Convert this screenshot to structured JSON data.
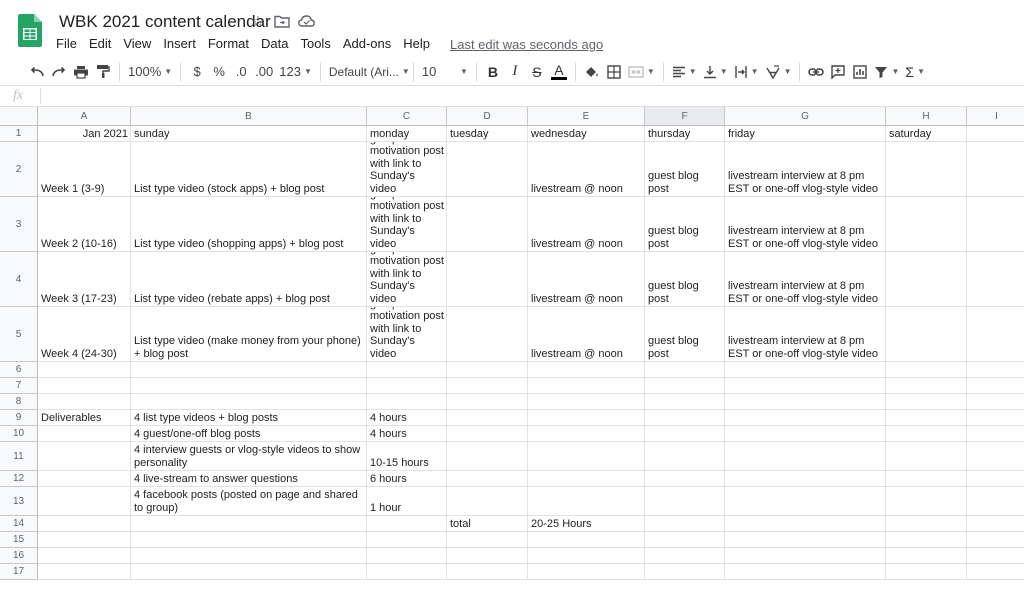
{
  "doc": {
    "title": "WBK 2021 content calendar",
    "last_edit": "Last edit was seconds ago"
  },
  "icons": {
    "star": "star-icon",
    "move": "folder-move-icon",
    "cloud": "cloud-status-icon"
  },
  "menu": [
    "File",
    "Edit",
    "View",
    "Insert",
    "Format",
    "Data",
    "Tools",
    "Add-ons",
    "Help"
  ],
  "toolbar": {
    "zoom": "100%",
    "currency": "$",
    "percent": "%",
    "decrease_decimal": ".0",
    "increase_decimal": ".00",
    "more_formats": "123",
    "font": "Default (Ari...",
    "font_size": "10",
    "bold": "B",
    "italic": "I",
    "strike": "S",
    "text_color": "A",
    "sum": "Σ"
  },
  "formula_bar": {
    "label": "fx",
    "content": ""
  },
  "columns": [
    "A",
    "B",
    "C",
    "D",
    "E",
    "F",
    "G",
    "H",
    "I"
  ],
  "selected_column": "F",
  "rows": [
    [
      "Jan 2021",
      "sunday",
      "monday",
      "tuesday",
      "wednesday",
      "thursday",
      "friday",
      "saturday",
      ""
    ],
    [
      "Week 1 (3-9)",
      "List type video (stock apps) + blog post",
      "facebook group motivation post with link to Sunday's video",
      "",
      "livestream @ noon",
      "guest blog post",
      "livestream interview at 8 pm EST or one-off vlog-style video",
      "",
      ""
    ],
    [
      "Week 2 (10-16)",
      "List type video (shopping apps) + blog post",
      "facebook group motivation post with link to Sunday's video",
      "",
      "livestream @ noon",
      "guest blog post",
      "livestream interview at 8 pm EST or one-off vlog-style video",
      "",
      ""
    ],
    [
      "Week 3 (17-23)",
      "List type video (rebate apps) + blog post",
      "facebook group motivation post with link to Sunday's video",
      "",
      "livestream @ noon",
      "guest blog post",
      "livestream interview at 8 pm EST or one-off vlog-style video",
      "",
      ""
    ],
    [
      "Week 4 (24-30)",
      "List type video (make money from your phone) + blog post",
      "facebook group motivation post with link to Sunday's video",
      "",
      "livestream @ noon",
      "guest blog post",
      "livestream interview at 8 pm EST or one-off vlog-style video",
      "",
      ""
    ],
    [
      "",
      "",
      "",
      "",
      "",
      "",
      "",
      "",
      ""
    ],
    [
      "",
      "",
      "",
      "",
      "",
      "",
      "",
      "",
      ""
    ],
    [
      "",
      "",
      "",
      "",
      "",
      "",
      "",
      "",
      ""
    ],
    [
      "Deliverables",
      "4 list type videos + blog posts",
      "4 hours",
      "",
      "",
      "",
      "",
      "",
      ""
    ],
    [
      "",
      "4 guest/one-off blog posts",
      "4 hours",
      "",
      "",
      "",
      "",
      "",
      ""
    ],
    [
      "",
      "4 interview guests or vlog-style videos to show personality",
      "10-15 hours",
      "",
      "",
      "",
      "",
      "",
      ""
    ],
    [
      "",
      "4 live-stream to answer questions",
      "6 hours",
      "",
      "",
      "",
      "",
      "",
      ""
    ],
    [
      "",
      "4 facebook posts (posted on page and shared to group)",
      "1 hour",
      "",
      "",
      "",
      "",
      "",
      ""
    ],
    [
      "",
      "",
      "",
      "total",
      "20-25 Hours",
      "",
      "",
      "",
      ""
    ],
    [
      "",
      "",
      "",
      "",
      "",
      "",
      "",
      "",
      ""
    ],
    [
      "",
      "",
      "",
      "",
      "",
      "",
      "",
      "",
      ""
    ],
    [
      "",
      "",
      "",
      "",
      "",
      "",
      "",
      "",
      ""
    ]
  ],
  "colors": {
    "sheets_green": "#23a566",
    "header_bg": "#f8f9fa",
    "selected_header_bg": "#e8eaed",
    "gridline": "#e2e2e2"
  }
}
